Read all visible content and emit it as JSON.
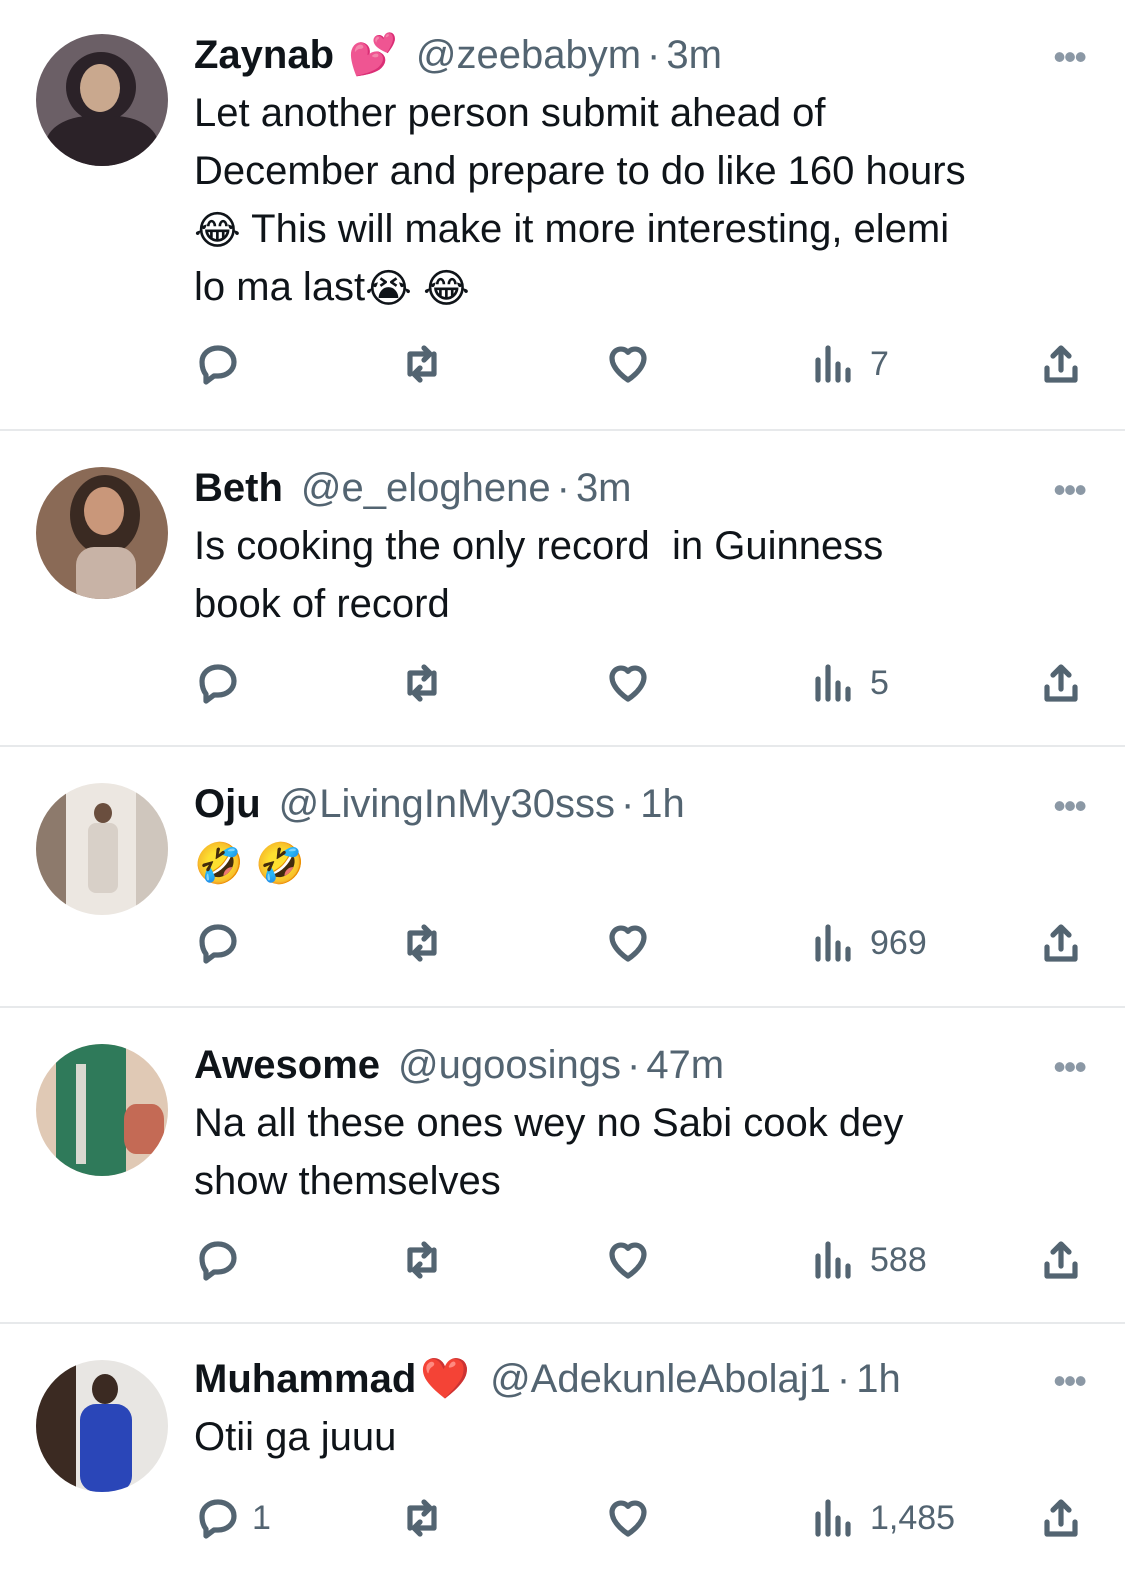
{
  "tweets": [
    {
      "name": "Zaynab",
      "name_emoji": "💕",
      "handle": "@zeebabym",
      "separator": "·",
      "time": "3m",
      "text_parts": [
        "Let another person submit ahead of\nDecember and prepare to do like 160 hours\n",
        "😂",
        " This will make it more interesting, elemi\nlo ma last",
        "😭",
        " ",
        "😂"
      ],
      "replies": "",
      "views": "7",
      "avatar_colors": [
        "#6b5f66",
        "#2b2228",
        "#c9a88e"
      ]
    },
    {
      "name": "Beth",
      "name_emoji": "",
      "handle": "@e_eloghene",
      "separator": "·",
      "time": "3m",
      "text_parts": [
        "Is cooking the only record  in Guinness\nbook of record"
      ],
      "replies": "",
      "views": "5",
      "avatar_colors": [
        "#8a6a56",
        "#c8b3a6",
        "#3a2a22"
      ]
    },
    {
      "name": "Oju",
      "name_emoji": "",
      "handle": "@LivingInMy30sss",
      "separator": "·",
      "time": "1h",
      "text_parts": [
        "🤣",
        " ",
        "🤣"
      ],
      "replies": "",
      "views": "969",
      "avatar_colors": [
        "#d8d0c8",
        "#ece7e1",
        "#8d7a6c"
      ]
    },
    {
      "name": "Awesome",
      "name_emoji": "",
      "handle": "@ugoosings",
      "separator": "·",
      "time": "47m",
      "text_parts": [
        "Na all these ones wey no Sabi cook dey\nshow themselves"
      ],
      "replies": "",
      "views": "588",
      "avatar_colors": [
        "#2f7a5a",
        "#e0c9b5",
        "#c46a55"
      ]
    },
    {
      "name": "Muhammad",
      "name_emoji": "❤️",
      "handle": "@AdekunleAbolaj1",
      "separator": "·",
      "time": "1h",
      "text_parts": [
        "Otii ga juuu"
      ],
      "replies": "1",
      "views": "1,485",
      "avatar_colors": [
        "#e8e6e3",
        "#2a46b8",
        "#3b2a22"
      ]
    }
  ],
  "more_glyph": "•••"
}
